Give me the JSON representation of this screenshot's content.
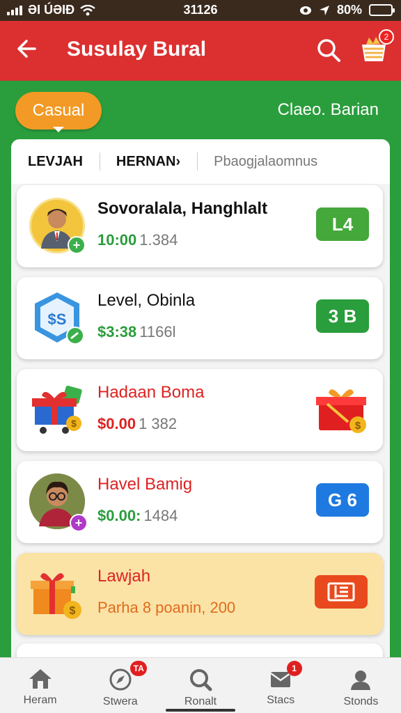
{
  "status_bar": {
    "carrier": "ƏI ÚƏIÐ",
    "time": "31126",
    "battery": "80%"
  },
  "app_bar": {
    "title": "Susulay Bural",
    "cart_badge": "2"
  },
  "filters": {
    "chip": "Casual",
    "right_label": "Claeo. Barian"
  },
  "tabs": [
    {
      "label": "LEVJAH"
    },
    {
      "label": "HERNAN›"
    },
    {
      "label": "Pbaogjalaomnus"
    }
  ],
  "cards": [
    {
      "name": "Sovoralala, Hanghlalt",
      "amount": "10:00",
      "sub": "1.384",
      "pill": "L4",
      "pill_color": "#45a83a",
      "style": "green"
    },
    {
      "name": "Level, Obinla",
      "amount": "$3:38",
      "sub": "1166l",
      "pill": "3 B",
      "pill_color": "#2a9d3c",
      "style": "green"
    },
    {
      "name": "Hadaan Boma",
      "amount": "$0.00",
      "sub": "1 382",
      "pill": "",
      "style": "red"
    },
    {
      "name": "Havel Bamig",
      "amount": "$0.00:",
      "sub": "1484",
      "pill": "G 6",
      "pill_color": "#1e7ae0",
      "style": "green"
    },
    {
      "name": "Lawjah",
      "amount": "Parha 8 poanin, 200",
      "sub": "",
      "style": "orange"
    }
  ],
  "bottom_nav": [
    {
      "label": "Heram",
      "badge": ""
    },
    {
      "label": "Stwera",
      "badge": "TA"
    },
    {
      "label": "Ronalt",
      "badge": ""
    },
    {
      "label": "Stacs",
      "badge": "1"
    },
    {
      "label": "Stonds",
      "badge": ""
    }
  ],
  "colors": {
    "header_red": "#dc3030",
    "bg_green": "#2a9d3c",
    "chip_orange": "#f29a25"
  },
  "icons": [
    "back-arrow-icon",
    "search-icon",
    "cart-icon",
    "home-icon",
    "compass-icon",
    "search-icon",
    "mail-icon",
    "user-icon"
  ]
}
